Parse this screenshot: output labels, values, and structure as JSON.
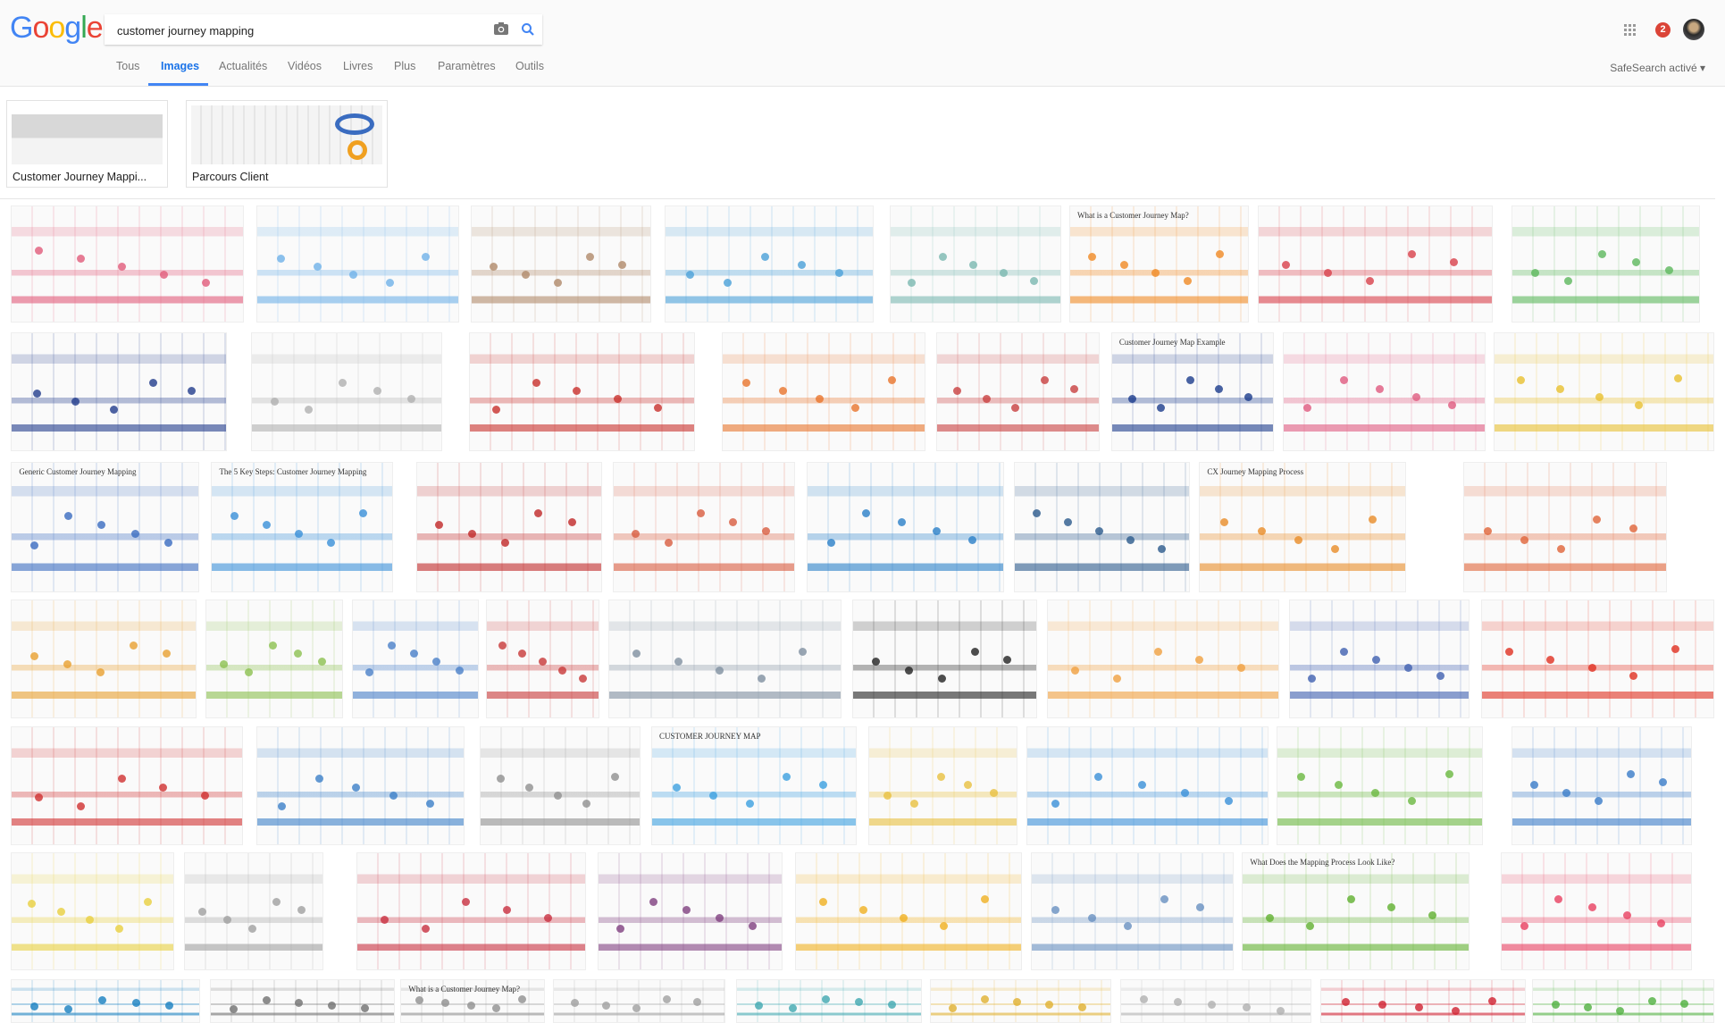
{
  "header": {
    "logo": "Google",
    "search": {
      "value": "customer journey mapping",
      "camera_icon": "camera-icon",
      "search_icon": "search-icon"
    },
    "apps_icon": "grid-icon",
    "notifications_count": "2",
    "avatar": "avatar",
    "tabs": [
      {
        "label": "Tous"
      },
      {
        "label": "Images",
        "active": true
      },
      {
        "label": "Actualités"
      },
      {
        "label": "Vidéos"
      },
      {
        "label": "Livres"
      },
      {
        "label": "Plus"
      },
      {
        "label": "Paramètres"
      },
      {
        "label": "Outils"
      }
    ],
    "safesearch": "SafeSearch activé ▾"
  },
  "related": [
    {
      "label": "Customer Journey Mappi..."
    },
    {
      "label": "Parcours Client"
    }
  ],
  "colors": {
    "accent": "#4285f4",
    "badge": "#db4437"
  },
  "results": [
    [
      {
        "c": "#e15b7a"
      },
      {
        "c": "#6fb1e8"
      },
      {
        "c": "#b08a6a"
      },
      {
        "c": "#4aa0d8"
      },
      {
        "c": "#7ab8b0"
      },
      {
        "c": "#f08a24",
        "title": "What is a Customer Journey Map?"
      },
      {
        "c": "#d8404a"
      },
      {
        "c": "#5cb85c"
      }
    ],
    [
      {
        "c": "#223c8c"
      },
      {
        "c": "#b0b0b0"
      },
      {
        "c": "#c8302c"
      },
      {
        "c": "#e8742c"
      },
      {
        "c": "#c84040"
      },
      {
        "c": "#1c3c8c",
        "title": "Customer Journey Map Example"
      },
      {
        "c": "#e05a80"
      },
      {
        "c": "#e8c030"
      }
    ],
    [
      {
        "c": "#3a6cc0",
        "title": "Generic Customer Journey Mapping"
      },
      {
        "c": "#3a90d8",
        "title": "The 5 Key Steps: Customer Journey Mapping"
      },
      {
        "c": "#c02828"
      },
      {
        "c": "#d85c40"
      },
      {
        "c": "#2a80c8"
      },
      {
        "c": "#2c5a8c"
      },
      {
        "c": "#e88c28",
        "title": "CX Journey Mapping Process"
      },
      {
        "c": "#e06438"
      }
    ],
    [
      {
        "c": "#e8a030"
      },
      {
        "c": "#8cc050"
      },
      {
        "c": "#4a80c8"
      },
      {
        "c": "#c83838"
      },
      {
        "c": "#8090a0"
      },
      {
        "c": "#222222"
      },
      {
        "c": "#f0a040"
      },
      {
        "c": "#4060b0"
      },
      {
        "c": "#e03020"
      }
    ],
    [
      {
        "c": "#d03030"
      },
      {
        "c": "#3c80c8"
      },
      {
        "c": "#909090"
      },
      {
        "c": "#3ca0e0",
        "title": "CUSTOMER JOURNEY MAP"
      },
      {
        "c": "#e8c040"
      },
      {
        "c": "#3a90d8"
      },
      {
        "c": "#6ab840"
      },
      {
        "c": "#3a7cc8"
      }
    ],
    [
      {
        "c": "#e8d040"
      },
      {
        "c": "#a0a0a0"
      },
      {
        "c": "#c83040"
      },
      {
        "c": "#804080"
      },
      {
        "c": "#f0b020"
      },
      {
        "c": "#6890c0"
      },
      {
        "c": "#60b030",
        "title": "What Does the Mapping Process Look Like?"
      },
      {
        "c": "#e84060"
      }
    ],
    [
      {
        "c": "#1880c0"
      },
      {
        "c": "#707070"
      },
      {
        "c": "#909090",
        "title": "What is a Customer Journey Map?"
      },
      {
        "c": "#a0a0a0"
      },
      {
        "c": "#40a8b0"
      },
      {
        "c": "#e0b030"
      },
      {
        "c": "#b0b0b0"
      },
      {
        "c": "#d02030"
      },
      {
        "c": "#50b040"
      }
    ]
  ]
}
